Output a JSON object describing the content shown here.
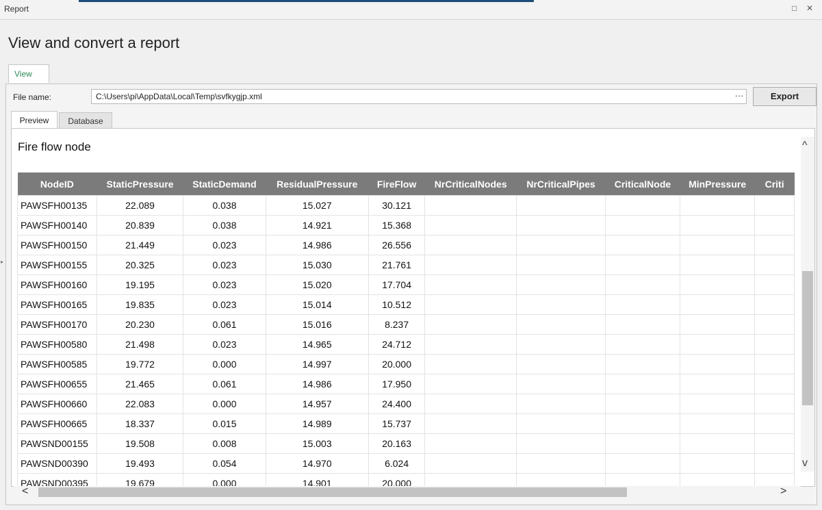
{
  "window": {
    "title": "Report",
    "restore_glyph": "□",
    "close_glyph": "✕"
  },
  "page": {
    "heading": "View and convert a report",
    "outer_tab": "View"
  },
  "file": {
    "label": "File name:",
    "value": "C:\\Users\\pi\\AppData\\Local\\Temp\\svfkygjp.xml",
    "browse": "···",
    "export_label": "Export"
  },
  "inner_tabs": {
    "preview": "Preview",
    "database": "Database"
  },
  "report": {
    "title": "Fire flow node",
    "columns": [
      "NodeID",
      "StaticPressure",
      "StaticDemand",
      "ResidualPressure",
      "FireFlow",
      "NrCriticalNodes",
      "NrCriticalPipes",
      "CriticalNode",
      "MinPressure",
      "Criti"
    ],
    "rows": [
      [
        "PAWSFH00135",
        "22.089",
        "0.038",
        "15.027",
        "30.121",
        "",
        "",
        "",
        "",
        ""
      ],
      [
        "PAWSFH00140",
        "20.839",
        "0.038",
        "14.921",
        "15.368",
        "",
        "",
        "",
        "",
        ""
      ],
      [
        "PAWSFH00150",
        "21.449",
        "0.023",
        "14.986",
        "26.556",
        "",
        "",
        "",
        "",
        ""
      ],
      [
        "PAWSFH00155",
        "20.325",
        "0.023",
        "15.030",
        "21.761",
        "",
        "",
        "",
        "",
        ""
      ],
      [
        "PAWSFH00160",
        "19.195",
        "0.023",
        "15.020",
        "17.704",
        "",
        "",
        "",
        "",
        ""
      ],
      [
        "PAWSFH00165",
        "19.835",
        "0.023",
        "15.014",
        "10.512",
        "",
        "",
        "",
        "",
        ""
      ],
      [
        "PAWSFH00170",
        "20.230",
        "0.061",
        "15.016",
        "8.237",
        "",
        "",
        "",
        "",
        ""
      ],
      [
        "PAWSFH00580",
        "21.498",
        "0.023",
        "14.965",
        "24.712",
        "",
        "",
        "",
        "",
        ""
      ],
      [
        "PAWSFH00585",
        "19.772",
        "0.000",
        "14.997",
        "20.000",
        "",
        "",
        "",
        "",
        ""
      ],
      [
        "PAWSFH00655",
        "21.465",
        "0.061",
        "14.986",
        "17.950",
        "",
        "",
        "",
        "",
        ""
      ],
      [
        "PAWSFH00660",
        "22.083",
        "0.000",
        "14.957",
        "24.400",
        "",
        "",
        "",
        "",
        ""
      ],
      [
        "PAWSFH00665",
        "18.337",
        "0.015",
        "14.989",
        "15.737",
        "",
        "",
        "",
        "",
        ""
      ],
      [
        "PAWSND00155",
        "19.508",
        "0.008",
        "15.003",
        "20.163",
        "",
        "",
        "",
        "",
        ""
      ],
      [
        "PAWSND00390",
        "19.493",
        "0.054",
        "14.970",
        "6.024",
        "",
        "",
        "",
        "",
        ""
      ],
      [
        "PAWSND00395",
        "19.679",
        "0.000",
        "14.901",
        "20.000",
        "",
        "",
        "",
        "",
        ""
      ]
    ]
  },
  "scroll": {
    "up": "^",
    "down": "v",
    "left": "<",
    "right": ">"
  }
}
